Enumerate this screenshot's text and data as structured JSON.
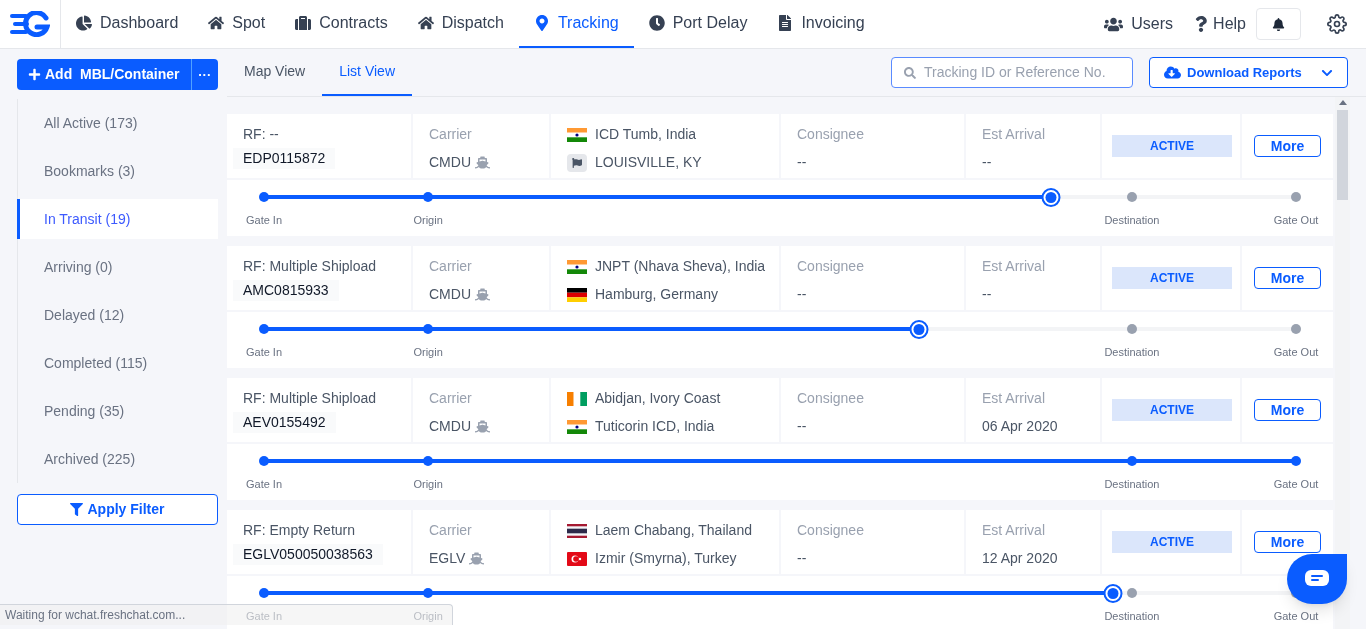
{
  "nav": {
    "items": [
      {
        "label": "Dashboard",
        "selected": false
      },
      {
        "label": "Spot",
        "selected": false
      },
      {
        "label": "Contracts",
        "selected": false
      },
      {
        "label": "Dispatch",
        "selected": false
      },
      {
        "label": "Tracking",
        "selected": true
      },
      {
        "label": "Port Delay",
        "selected": false
      },
      {
        "label": "Invoicing",
        "selected": false
      }
    ],
    "right": {
      "users": "Users",
      "help": "Help"
    }
  },
  "add_button": {
    "label": "Add  MBL/Container",
    "more": "···"
  },
  "view_tabs": [
    {
      "label": "Map View",
      "selected": false
    },
    {
      "label": "List View",
      "selected": true
    }
  ],
  "search": {
    "placeholder": "Tracking ID or Reference No."
  },
  "download_button": "Download Reports",
  "filters": [
    {
      "label": "All Active (173)",
      "selected": false
    },
    {
      "label": "Bookmarks (3)",
      "selected": false
    },
    {
      "label": "In Transit (19)",
      "selected": true
    },
    {
      "label": "Arriving (0)",
      "selected": false
    },
    {
      "label": "Delayed (12)",
      "selected": false
    },
    {
      "label": "Completed (115)",
      "selected": false
    },
    {
      "label": "Pending (35)",
      "selected": false
    },
    {
      "label": "Archived (225)",
      "selected": false
    }
  ],
  "apply_filter": "Apply Filter",
  "shipments": [
    {
      "rf": "RF: --",
      "id": "EDP0115872",
      "carrier_label": "Carrier",
      "carrier": "CMDU",
      "origin": {
        "kind": "india",
        "name": "ICD Tumb, India"
      },
      "destination": {
        "kind": "generic",
        "name": "LOUISVILLE, KY"
      },
      "consignee_label": "Consignee",
      "consignee": "--",
      "arrival_label": "Est Arrival",
      "arrival": "--",
      "status": "ACTIVE",
      "more": "More",
      "level": 0.763,
      "stops": [
        "Gate In",
        "Origin",
        "Destination",
        "Gate Out"
      ]
    },
    {
      "rf": "RF: Multiple Shipload",
      "id": "AMC0815933",
      "carrier_label": "Carrier",
      "carrier": "CMDU",
      "origin": {
        "kind": "india",
        "name": "JNPT (Nhava Sheva), India"
      },
      "destination": {
        "kind": "germany",
        "name": "Hamburg, Germany"
      },
      "consignee_label": "Consignee",
      "consignee": "--",
      "arrival_label": "Est Arrival",
      "arrival": "--",
      "status": "ACTIVE",
      "more": "More",
      "level": 0.635,
      "stops": [
        "Gate In",
        "Origin",
        "Destination",
        "Gate Out"
      ]
    },
    {
      "rf": "RF: Multiple Shipload",
      "id": "AEV0155492",
      "carrier_label": "Carrier",
      "carrier": "CMDU",
      "origin": {
        "kind": "ivory_coast",
        "name": "Abidjan, Ivory Coast"
      },
      "destination": {
        "kind": "india",
        "name": "Tuticorin ICD, India"
      },
      "consignee_label": "Consignee",
      "consignee": "--",
      "arrival_label": "Est Arrival",
      "arrival": "06 Apr 2020",
      "status": "ACTIVE",
      "more": "More",
      "level": 1,
      "stops": [
        "Gate In",
        "Origin",
        "Destination",
        "Gate Out"
      ]
    },
    {
      "rf": "RF: Empty Return",
      "id": "EGLV050050038563",
      "carrier_label": "Carrier",
      "carrier": "EGLV",
      "origin": {
        "kind": "thailand",
        "name": "Laem Chabang, Thailand"
      },
      "destination": {
        "kind": "turkey",
        "name": "Izmir (Smyrna), Turkey"
      },
      "consignee_label": "Consignee",
      "consignee": "--",
      "arrival_label": "Est Arrival",
      "arrival": "12 Apr 2020",
      "status": "ACTIVE",
      "more": "More",
      "level": 0.823,
      "stops": [
        "Gate In",
        "Origin",
        "Destination",
        "Gate Out"
      ]
    }
  ],
  "browser_status": "Waiting for wchat.freshchat.com..."
}
